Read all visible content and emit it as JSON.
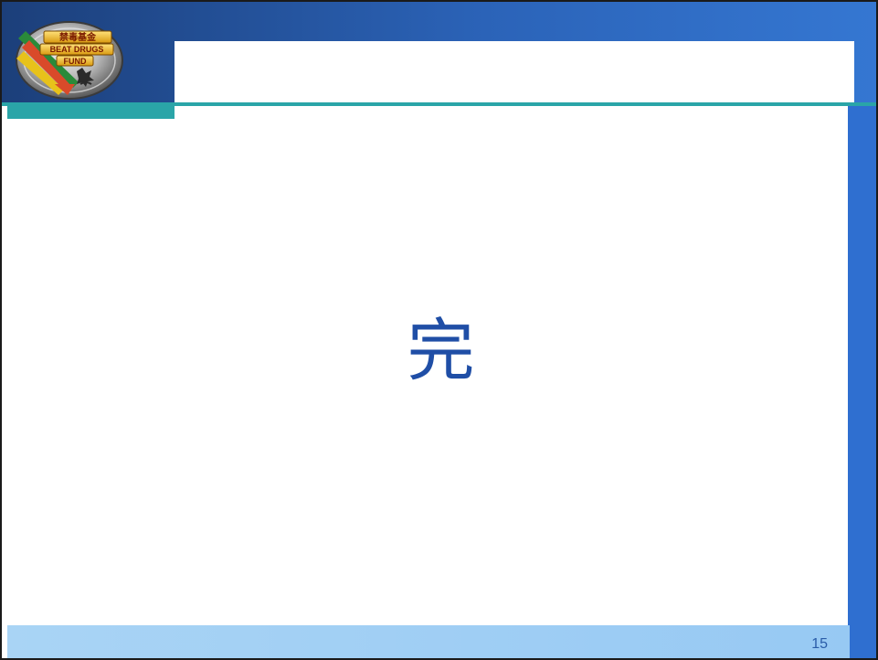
{
  "slide": {
    "body_text": "完",
    "page_number": "15"
  },
  "logo": {
    "text_lines": [
      "禁毒基金",
      "BEAT DRUGS",
      "FUND"
    ]
  },
  "colors": {
    "header_gradient_start": "#1c3f7a",
    "header_gradient_end": "#3577d2",
    "right_bar": "#2f6fd0",
    "teal_accent": "#2aa5a8",
    "footer_bar": "#a9d4f5",
    "text_blue": "#1f4ea6"
  }
}
